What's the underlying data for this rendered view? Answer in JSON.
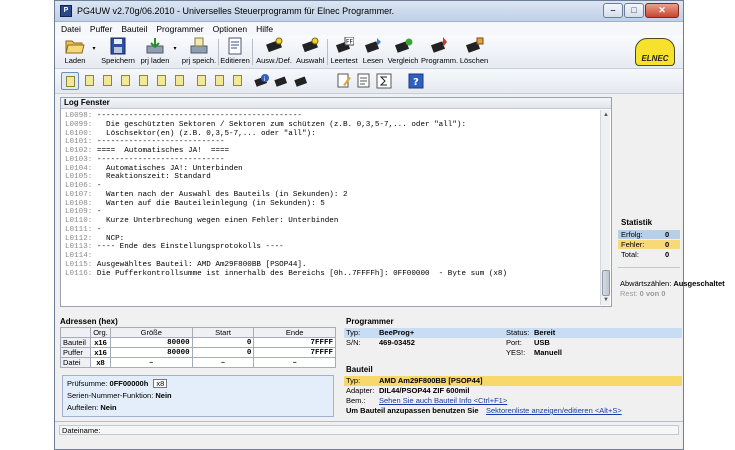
{
  "window": {
    "title": "PG4UW v2.70g/06.2010 - Universelles Steuerprogramm für Elnec Programmer.",
    "icon_label": "P",
    "buttons": {
      "minimize": "–",
      "maximize": "□",
      "close": "✕"
    }
  },
  "menu": [
    "Datei",
    "Puffer",
    "Bauteil",
    "Programmer",
    "Optionen",
    "Hilfe"
  ],
  "toolbar": {
    "laden": "Laden",
    "speichern": "Speichern",
    "prj_laden": "prj laden",
    "prj_speich": "prj speich.",
    "editieren": "Editieren",
    "ausw_def": "Ausw./Def.",
    "auswahl": "Auswahl",
    "leertest": "Leertest",
    "lesen": "Lesen",
    "vergleich": "Vergleich",
    "programm": "Programm.",
    "loeschen": "Löschen",
    "logo": "ELNEC",
    "ff_badge": "FF",
    "info_badge": "i",
    "help_badge": "?"
  },
  "log": {
    "title": "Log Fenster",
    "lines": [
      {
        "n": "L0098:",
        "t": " ---------------------------------------------"
      },
      {
        "n": "L0099:",
        "t": "   Die geschützten Sektoren / Sektoren zum schützen (z.B. 0,3,5-7,... oder \"all\"):"
      },
      {
        "n": "L0100:",
        "t": "   Löschsektor(en) (z.B. 0,3,5-7,... oder \"all\"):"
      },
      {
        "n": "L0101:",
        "t": " ----------------------------"
      },
      {
        "n": "L0102:",
        "t": " ====  Automatisches JA!  ===="
      },
      {
        "n": "L0103:",
        "t": " ----------------------------"
      },
      {
        "n": "L0104:",
        "t": "   Automatisches JA!: Unterbinden"
      },
      {
        "n": "L0105:",
        "t": "   Reaktionszeit: Standard"
      },
      {
        "n": "L0106:",
        "t": " -"
      },
      {
        "n": "L0107:",
        "t": "   Warten nach der Auswahl des Bauteils (in Sekunden): 2"
      },
      {
        "n": "L0108:",
        "t": "   Warten auf die Bauteileinlegung (in Sekunden): 5"
      },
      {
        "n": "L0109:",
        "t": " -"
      },
      {
        "n": "L0110:",
        "t": "   Kurze Unterbrechung wegen einen Fehler: Unterbinden"
      },
      {
        "n": "L0111:",
        "t": " -"
      },
      {
        "n": "L0112:",
        "t": "   NCP:"
      },
      {
        "n": "L0113:",
        "t": " ---- Ende des Einstellungsprotokolls ----"
      },
      {
        "n": "L0114:",
        "t": ""
      },
      {
        "n": "L0115:",
        "t": " Ausgewähltes Bauteil: AMD Am29F800BB [PSOP44]."
      },
      {
        "n": "L0116:",
        "t": " Die Pufferkontrollsumme ist innerhalb des Bereichs [0h..7FFFFh]: 0FF00000  - Byte sum (x8)"
      }
    ]
  },
  "statistik": {
    "title": "Statistik",
    "erfolg_label": "Erfolg:",
    "erfolg_value": "0",
    "fehler_label": "Fehler:",
    "fehler_value": "0",
    "total_label": "Total:",
    "total_value": "0",
    "abwaerts_label": "Abwärtszählen:",
    "abwaerts_value": "Ausgeschaltet",
    "rest_label": "Rest:",
    "rest_value": "0 von 0"
  },
  "adressen": {
    "title": "Adressen (hex)",
    "headers": [
      "",
      "Org.",
      "Größe",
      "Start",
      "Ende"
    ],
    "rows": [
      {
        "label": "Bauteil",
        "org": "x16",
        "groesse": "80000",
        "start": "0",
        "ende": "7FFFF"
      },
      {
        "label": "Puffer",
        "org": "x16",
        "groesse": "80000",
        "start": "0",
        "ende": "7FFFF"
      },
      {
        "label": "Datei",
        "org": "x8",
        "groesse": "–",
        "start": "–",
        "ende": "–"
      }
    ]
  },
  "info": {
    "pruefsumme_label": "Prüfsumme:",
    "pruefsumme_value": "0FF00000h",
    "pruefsumme_chip": "x8",
    "serien_label": "Serien-Nummer-Funktion:",
    "serien_value": "Nein",
    "aufteilen_label": "Aufteilen:",
    "aufteilen_value": "Nein"
  },
  "programmer": {
    "title": "Programmer",
    "typ_label": "Typ:",
    "typ_value": "BeeProg+",
    "sn_label": "S/N:",
    "sn_value": "469-03452",
    "status_label": "Status:",
    "status_value": "Bereit",
    "port_label": "Port:",
    "port_value": "USB",
    "yes_label": "YES!:",
    "yes_value": "Manuell"
  },
  "bauteil": {
    "title": "Bauteil",
    "typ_label": "Typ:",
    "typ_value": "AMD  Am29F800BB [PSOP44]",
    "adapter_label": "Adapter:",
    "adapter_value": "DIL44/PSOP44 ZIF 600mil",
    "bem_label": "Bem.:",
    "bem_link": "Sehen Sie auch Bauteil Info <Ctrl+F1>",
    "hint_text": "Um Bauteil anzupassen benutzen Sie",
    "hint_link": "Sektorenliste anzeigen/editieren <Alt+S>"
  },
  "status": {
    "dateiname_label": "Dateiname:"
  }
}
